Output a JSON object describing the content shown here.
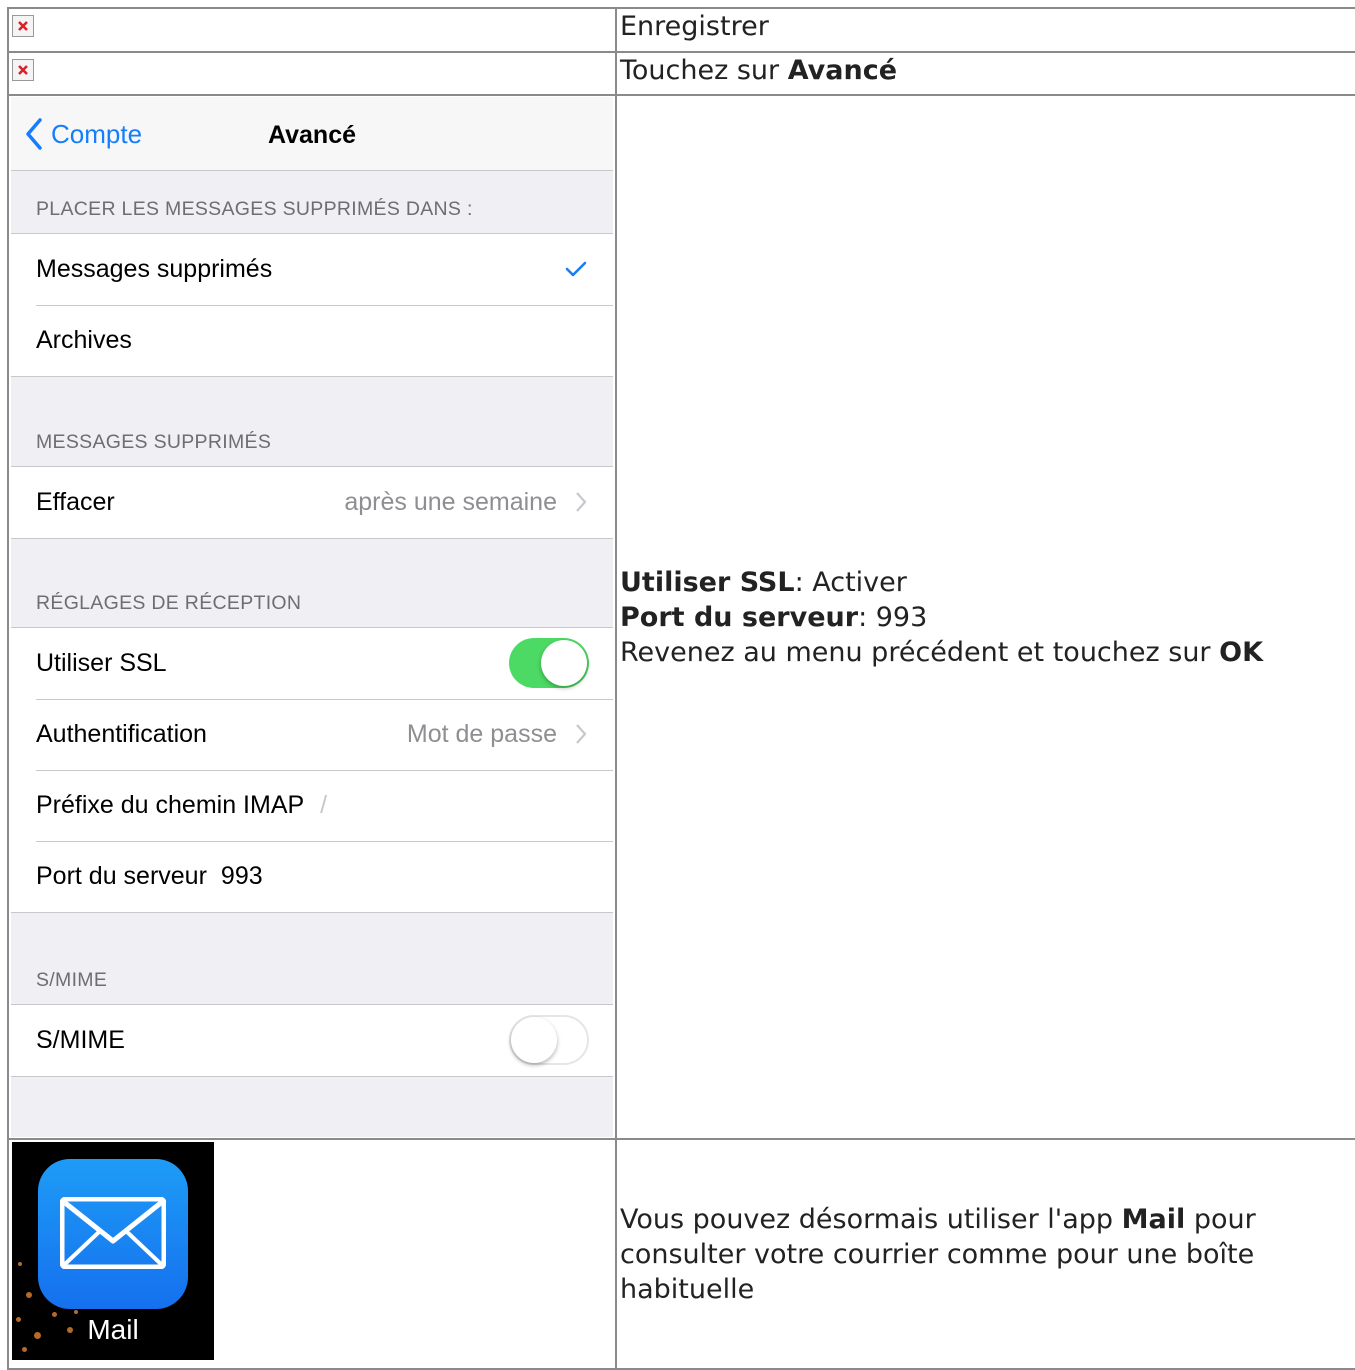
{
  "rows": [
    {
      "text": "Enregistrer"
    },
    {
      "text_prefix": "Touchez sur ",
      "text_bold": "Avancé"
    }
  ],
  "instructions": {
    "ssl_label": "Utiliser SSL",
    "ssl_value": ": Activer",
    "port_label": "Port du serveur",
    "port_value": ": 993",
    "return_prefix": "Revenez au menu précédent et touchez sur ",
    "return_bold": "OK"
  },
  "final": {
    "prefix": "Vous pouvez désormais utiliser l'app ",
    "bold": "Mail",
    "suffix": " pour consulter votre courrier comme pour une boîte habituelle",
    "icon_label": "Mail"
  },
  "ios": {
    "back_label": "Compte",
    "title": "Avancé",
    "accent_color": "#157efb",
    "sections": {
      "deleted_into_header": "PLACER LES MESSAGES SUPPRIMÉS DANS :",
      "deleted_into_items": [
        "Messages supprimés",
        "Archives"
      ],
      "deleted_header": "MESSAGES SUPPRIMÉS",
      "erase_label": "Effacer",
      "erase_value": "après une semaine",
      "receive_header": "RÉGLAGES DE RÉCEPTION",
      "ssl_label": "Utiliser SSL",
      "ssl_on": true,
      "auth_label": "Authentification",
      "auth_value": "Mot de passe",
      "imap_label": "Préfixe du chemin IMAP",
      "imap_value": "/",
      "port_label": "Port du serveur",
      "port_value": "993",
      "smime_header": "S/MIME",
      "smime_label": "S/MIME",
      "smime_on": false
    }
  }
}
